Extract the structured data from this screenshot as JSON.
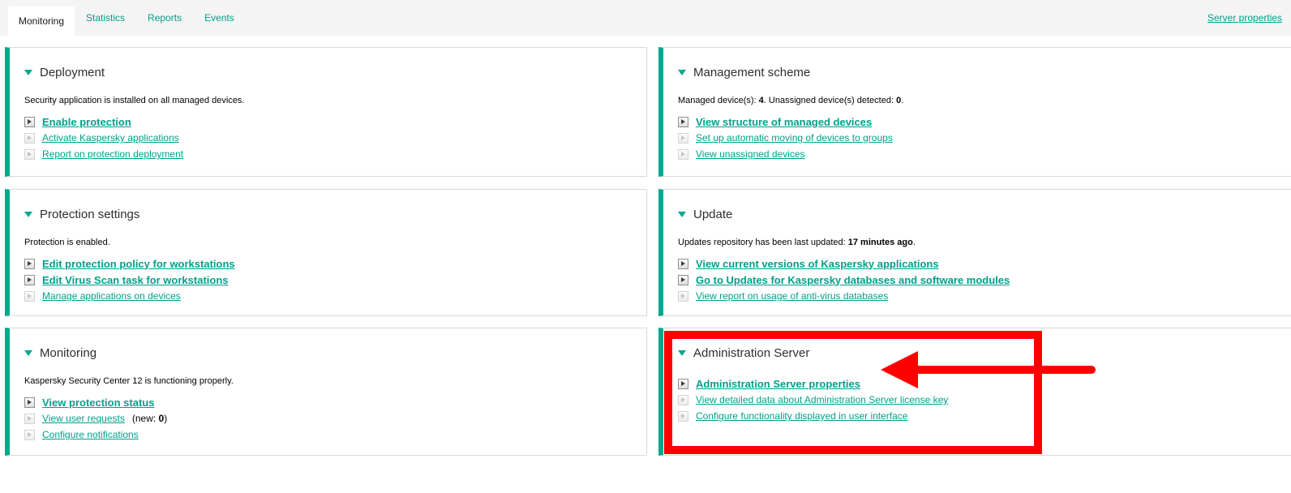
{
  "colors": {
    "accent_teal": "#00a88e",
    "link_teal": "#00a08a",
    "annotation_red": "#ff0000",
    "tab_bar_bg": "#f4f4f4"
  },
  "tab_bar": {
    "tabs": [
      {
        "label": "Monitoring",
        "active": true
      },
      {
        "label": "Statistics",
        "active": false
      },
      {
        "label": "Reports",
        "active": false
      },
      {
        "label": "Events",
        "active": false
      }
    ],
    "server_properties_link": "Server properties"
  },
  "panels": [
    {
      "title": "Deployment",
      "status_parts": [
        {
          "text": "Security application is installed on all managed devices.",
          "bold": false
        }
      ],
      "links": [
        {
          "label": "Enable protection",
          "emphasis": true
        },
        {
          "label": "Activate Kaspersky applications",
          "emphasis": false
        },
        {
          "label": "Report on protection deployment",
          "emphasis": false
        }
      ]
    },
    {
      "title": "Management scheme",
      "status_parts": [
        {
          "text": "Managed device(s): ",
          "bold": false
        },
        {
          "text": "4",
          "bold": true
        },
        {
          "text": ". Unassigned device(s) detected: ",
          "bold": false
        },
        {
          "text": "0",
          "bold": true
        },
        {
          "text": ".",
          "bold": false
        }
      ],
      "links": [
        {
          "label": "View structure of managed devices",
          "emphasis": true
        },
        {
          "label": "Set up automatic moving of devices to groups",
          "emphasis": false
        },
        {
          "label": "View unassigned devices",
          "emphasis": false
        }
      ]
    },
    {
      "title": "Protection settings",
      "status_parts": [
        {
          "text": "Protection is enabled.",
          "bold": false
        }
      ],
      "links": [
        {
          "label": "Edit protection policy for workstations",
          "emphasis": true
        },
        {
          "label": "Edit Virus Scan task for workstations",
          "emphasis": true
        },
        {
          "label": "Manage applications on devices",
          "emphasis": false
        }
      ]
    },
    {
      "title": "Update",
      "status_parts": [
        {
          "text": "Updates repository has been last updated: ",
          "bold": false
        },
        {
          "text": "17 minutes ago",
          "bold": true
        },
        {
          "text": ".",
          "bold": false
        }
      ],
      "links": [
        {
          "label": "View current versions of Kaspersky applications",
          "emphasis": true
        },
        {
          "label": "Go to Updates for Kaspersky databases and software modules",
          "emphasis": true
        },
        {
          "label": "View report on usage of anti-virus databases",
          "emphasis": false
        }
      ]
    },
    {
      "title": "Monitoring",
      "status_parts": [
        {
          "text": "Kaspersky Security Center 12 is functioning properly.",
          "bold": false
        }
      ],
      "links": [
        {
          "label": "View protection status",
          "emphasis": true
        },
        {
          "label": "View user requests",
          "emphasis": false,
          "suffix_parts": [
            {
              "text": " (new: ",
              "bold": false
            },
            {
              "text": "0",
              "bold": true
            },
            {
              "text": ")",
              "bold": false
            }
          ]
        },
        {
          "label": "Configure notifications",
          "emphasis": false
        }
      ]
    },
    {
      "title": "Administration Server",
      "status_parts": [],
      "links": [
        {
          "label": "Administration Server properties",
          "emphasis": true
        },
        {
          "label": "View detailed data about Administration Server license key",
          "emphasis": false
        },
        {
          "label": "Configure functionality displayed in user interface",
          "emphasis": false
        }
      ]
    }
  ],
  "annotation": {
    "shape": "rectangle-with-left-arrow",
    "color": "#ff0000"
  }
}
